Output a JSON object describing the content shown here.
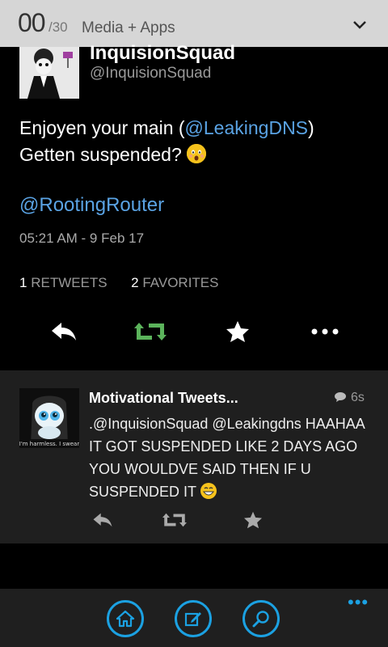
{
  "header": {
    "count": "00",
    "total": "/30",
    "section": "Media + Apps",
    "chevron_icon": "chevron-down-icon"
  },
  "main_tweet": {
    "display_name": "InquisionSquad",
    "handle": "@InquisionSquad",
    "text_part1": "Enjoyen your main (",
    "mention1": "@LeakingDNS",
    "text_part2": ")",
    "text_line2": "Getten suspended?",
    "emoji_icon": "astonished-face-emoji",
    "mention_line": "@RootingRouter",
    "timestamp": "05:21 AM - 9 Feb 17",
    "retweets_count": "1",
    "retweets_label": "RETWEETS",
    "favorites_count": "2",
    "favorites_label": "FAVORITES",
    "actions": [
      "reply-icon",
      "retweet-icon",
      "favorite-icon",
      "more-icon"
    ],
    "retweet_color": "#5bb35b"
  },
  "reply": {
    "name": "Motivational Tweets...",
    "time": "6s",
    "text": ".@InquisionSquad @Leakingdns HAAHAA IT GOT SUSPENDED LIKE 2 DAYS AGO YOU WOULDVE SAID THEN IF U SUSPENDED IT",
    "emoji_icon": "grinning-face-emoji",
    "avatar_caption": "I'm harmless. I swear",
    "actions": [
      "reply-icon",
      "retweet-icon",
      "favorite-icon"
    ]
  },
  "appbar": {
    "buttons": [
      "home-icon",
      "compose-icon",
      "search-icon"
    ],
    "more": "•••",
    "accent": "#1ba1e2"
  }
}
